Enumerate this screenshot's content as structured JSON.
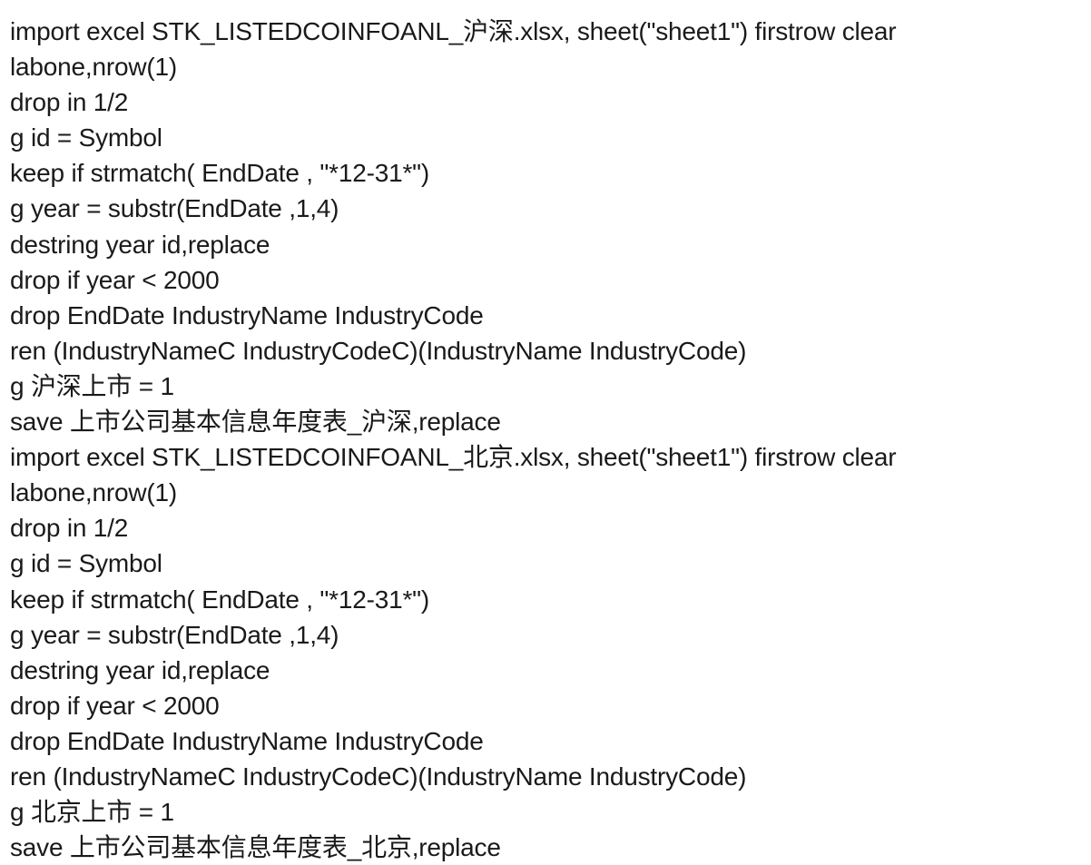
{
  "document": {
    "lines": [
      "import excel STK_LISTEDCOINFOANL_沪深.xlsx, sheet(\"sheet1\") firstrow clear",
      "labone,nrow(1)",
      "drop in 1/2",
      "g id = Symbol",
      "keep if strmatch( EndDate , \"*12-31*\")",
      "g year = substr(EndDate ,1,4)",
      "destring year id,replace",
      "drop if year < 2000",
      "drop EndDate IndustryName IndustryCode",
      "ren (IndustryNameC IndustryCodeC)(IndustryName IndustryCode)",
      "g 沪深上市 = 1",
      "save 上市公司基本信息年度表_沪深,replace",
      "import excel STK_LISTEDCOINFOANL_北京.xlsx, sheet(\"sheet1\") firstrow clear",
      "labone,nrow(1)",
      "drop in 1/2",
      "g id = Symbol",
      "keep if strmatch( EndDate , \"*12-31*\")",
      "g year = substr(EndDate ,1,4)",
      "destring year id,replace",
      "drop if year < 2000",
      "drop EndDate IndustryName IndustryCode",
      "ren (IndustryNameC IndustryCodeC)(IndustryName IndustryCode)",
      "g 北京上市 = 1",
      "save 上市公司基本信息年度表_北京,replace"
    ]
  }
}
